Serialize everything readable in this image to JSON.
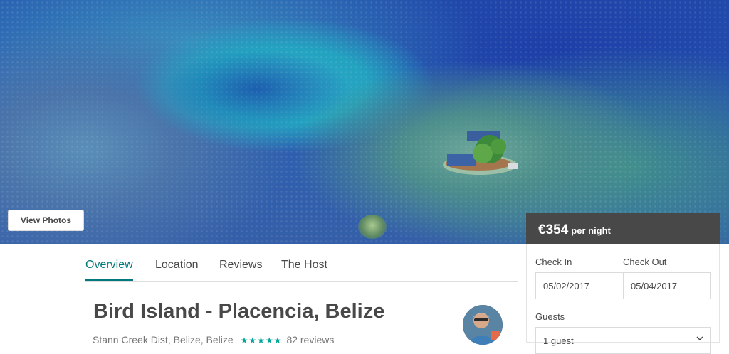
{
  "hero": {
    "view_photos_label": "View Photos"
  },
  "tabs": [
    {
      "label": "Overview",
      "active": true
    },
    {
      "label": "Location",
      "active": false
    },
    {
      "label": "Reviews",
      "active": false
    },
    {
      "label": "The Host",
      "active": false
    }
  ],
  "listing": {
    "title": "Bird Island - Placencia, Belize",
    "location": "Stann Creek Dist, Belize, Belize",
    "rating_stars": 5,
    "stars_glyphs": "★★★★★",
    "reviews": "82 reviews"
  },
  "booking": {
    "price": "€354",
    "per_night": "per night",
    "check_in_label": "Check In",
    "check_out_label": "Check Out",
    "check_in_value": "05/02/2017",
    "check_out_value": "05/04/2017",
    "guests_label": "Guests",
    "guests_value": "1 guest"
  },
  "colors": {
    "accent": "#00797c",
    "stars": "#00a699",
    "price_bar": "#484848"
  },
  "icons": {
    "dropdown": "chevron-down-icon",
    "avatar": "host-avatar"
  }
}
